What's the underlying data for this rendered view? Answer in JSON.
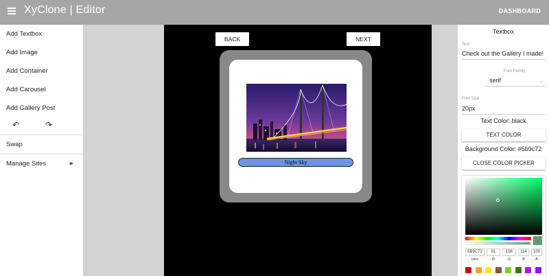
{
  "app": {
    "title": "XyClone | Editor",
    "dashboard_label": "DASHBOARD"
  },
  "sidebar": {
    "items": [
      {
        "label": "Add Textbox"
      },
      {
        "label": "Add Image"
      },
      {
        "label": "Add Container"
      },
      {
        "label": "Add Carousel"
      },
      {
        "label": "Add Gallery Post"
      }
    ],
    "swap_label": "Swap",
    "manage_label": "Manage Sites"
  },
  "canvas": {
    "back_label": "BACK",
    "next_label": "NEXT",
    "caption": "Night Sky"
  },
  "panel": {
    "title": "Textbox",
    "text_label": "Text",
    "text_value": "Check out the Gallery I made!",
    "font_family_label": "Font Family",
    "font_family_value": "serif",
    "font_size_label": "Font Size",
    "font_size_value": "20px",
    "text_color": "Text Color: black",
    "text_color_button": "TEXT COLOR",
    "background_color": "Background Color: #5b9c72",
    "close_picker_button": "CLOSE COLOR PICKER"
  },
  "picker": {
    "hex": "5B9C72",
    "r": "91",
    "g": "156",
    "b": "114",
    "a": "100",
    "labels": {
      "hex": "Hex",
      "r": "R",
      "g": "G",
      "b": "B",
      "a": "A"
    },
    "selected_color": "#5b9c72",
    "preset_colors": [
      "#d0021b",
      "#f5a623",
      "#f8e71c",
      "#8b572a",
      "#7ed321",
      "#417505",
      "#bd10e0",
      "#9013fe"
    ]
  }
}
